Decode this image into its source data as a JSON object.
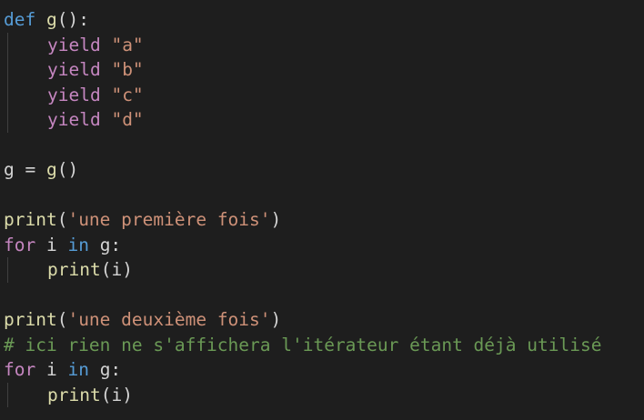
{
  "code": {
    "l1": {
      "kw": "def",
      "name": "g",
      "rest": "():"
    },
    "l2": {
      "kw": "yield",
      "val": "\"a\""
    },
    "l3": {
      "kw": "yield",
      "val": "\"b\""
    },
    "l4": {
      "kw": "yield",
      "val": "\"c\""
    },
    "l5": {
      "kw": "yield",
      "val": "\"d\""
    },
    "l7": {
      "lhs": "g",
      "op": " = ",
      "call": "g",
      "rest": "()"
    },
    "l9": {
      "fn": "print",
      "open": "(",
      "str": "'une première fois'",
      "close": ")"
    },
    "l10": {
      "kw": "for",
      "var": " i ",
      "kw2": "in",
      "rest": " g:"
    },
    "l11": {
      "fn": "print",
      "open": "(",
      "var": "i",
      "close": ")"
    },
    "l13": {
      "fn": "print",
      "open": "(",
      "str": "'une deuxième fois'",
      "close": ")"
    },
    "l14": {
      "comment": "# ici rien ne s'affichera l'itérateur étant déjà utilisé"
    },
    "l15": {
      "kw": "for",
      "var": " i ",
      "kw2": "in",
      "rest": " g:"
    },
    "l16": {
      "fn": "print",
      "open": "(",
      "var": "i",
      "close": ")"
    }
  },
  "colors": {
    "background": "#1e1e1e",
    "keyword_blue": "#569cd6",
    "keyword_purple": "#c586c0",
    "function": "#dcdcaa",
    "string": "#ce9178",
    "comment": "#6a9955"
  }
}
